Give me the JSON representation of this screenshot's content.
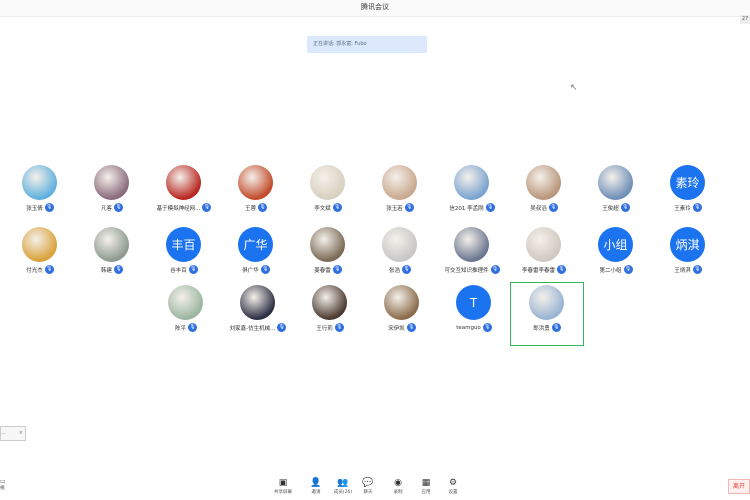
{
  "window": {
    "title": "腾讯会议"
  },
  "speaking": {
    "text": "正在讲话: 郭永富; Fubo"
  },
  "participants": [
    {
      "name": "张玉倩",
      "avatar": "photo",
      "color": "#5fb0de"
    },
    {
      "name": "凡客",
      "avatar": "photo",
      "color": "#8a6a7c"
    },
    {
      "name": "基于模拟神经网...",
      "avatar": "photo",
      "color": "#b8261f"
    },
    {
      "name": "王蓉",
      "avatar": "photo",
      "color": "#c44a2a"
    },
    {
      "name": "李文斌",
      "avatar": "photo",
      "color": "#d8d0bf"
    },
    {
      "name": "张玉若",
      "avatar": "photo",
      "color": "#c9a88f"
    },
    {
      "name": "信201 李孟刚",
      "avatar": "photo",
      "color": "#7aa3cf"
    },
    {
      "name": "吴叔滔",
      "avatar": "photo",
      "color": "#b8967a"
    },
    {
      "name": "王俊超",
      "avatar": "photo",
      "color": "#6f8fb8"
    },
    {
      "name": "王素玲",
      "avatar": "text",
      "text": "素玲"
    },
    {
      "name": "付光杰",
      "avatar": "photo",
      "color": "#d9a23a"
    },
    {
      "name": "韩建",
      "avatar": "photo",
      "color": "#8d9a8f"
    },
    {
      "name": "谷丰百",
      "avatar": "text",
      "text": "丰百"
    },
    {
      "name": "俱广华",
      "avatar": "text",
      "text": "广华"
    },
    {
      "name": "姜春雷",
      "avatar": "photo",
      "color": "#7a6a55"
    },
    {
      "name": "张浩",
      "avatar": "photo",
      "color": "#c7c7c7"
    },
    {
      "name": "可交互知识推理件",
      "avatar": "photo",
      "color": "#6a7690"
    },
    {
      "name": "李春雷李春雷",
      "avatar": "photo",
      "color": "#d0c8c0"
    },
    {
      "name": "第二小组",
      "avatar": "text",
      "text": "小组"
    },
    {
      "name": "王炳淇",
      "avatar": "text",
      "text": "炳淇"
    },
    {
      "name": "陈平",
      "avatar": "photo",
      "color": "#9bb6a0"
    },
    {
      "name": "刘家鑫-仿生机械...",
      "avatar": "photo",
      "color": "#2c2f44"
    },
    {
      "name": "王行莉",
      "avatar": "photo",
      "color": "#4b3a30"
    },
    {
      "name": "宋伊凯",
      "avatar": "photo",
      "color": "#8a6b4a"
    },
    {
      "name": "teamguo",
      "avatar": "text",
      "text": "T"
    },
    {
      "name": "郎洪勇",
      "avatar": "photo",
      "color": "#9ab4d4"
    }
  ],
  "toolbar": [
    {
      "label": "共享屏幕",
      "icon": "share-screen-icon",
      "glyph": "▣"
    },
    {
      "label": "邀请",
      "icon": "invite-icon",
      "glyph": "👤"
    },
    {
      "label": "成员(26)",
      "icon": "members-icon",
      "glyph": "👥"
    },
    {
      "label": "聊天",
      "icon": "chat-icon",
      "glyph": "💬"
    },
    {
      "label": "录制",
      "icon": "record-icon",
      "glyph": "◉"
    },
    {
      "label": "应用",
      "icon": "apps-icon",
      "glyph": "▦"
    },
    {
      "label": "设置",
      "icon": "settings-icon",
      "glyph": "⚙"
    }
  ],
  "left_chip": {
    "text": "...",
    "close": "×"
  },
  "left_edge": {
    "label": "视"
  },
  "end": {
    "label": "离开"
  },
  "corner": {
    "text": "27"
  }
}
